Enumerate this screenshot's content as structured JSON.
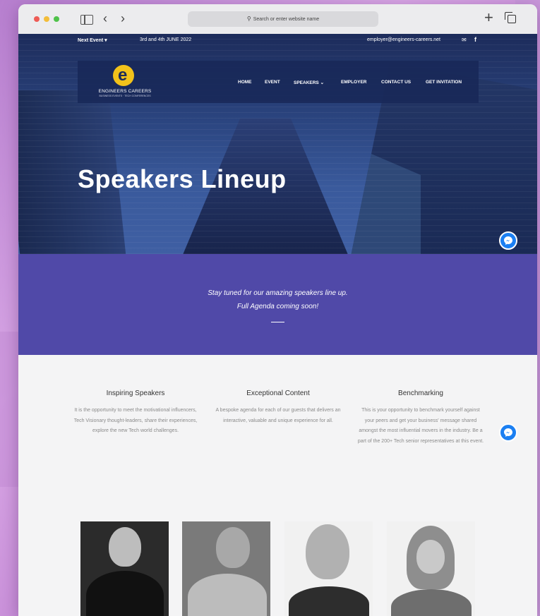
{
  "browser": {
    "address_placeholder": "Search or enter website name"
  },
  "topbar": {
    "next_event": "Next Event",
    "date": "3rd and 4th JUNE 2022",
    "email": "employer@engineers-careers.net"
  },
  "logo": {
    "name": "ENGINEERS CAREERS",
    "tagline": "BUSINESS EVENTS · TECH CONFERENCES"
  },
  "nav": [
    "HOME",
    "EVENT",
    "SPEAKERS",
    "EMPLOYER",
    "CONTACT US",
    "GET INVITATION"
  ],
  "hero": {
    "title": "Speakers Lineup"
  },
  "band": {
    "line1": "Stay tuned for our amazing speakers line up.",
    "line2": "Full Agenda coming soon!"
  },
  "features": [
    {
      "title": "Inspiring Speakers",
      "body": "It is the opportunity to meet the motivational influencers, Tech Visionary thought-leaders, share their experiences, explore the new Tech world challenges."
    },
    {
      "title": "Exceptional Content",
      "body": "A bespoke agenda for each of our guests that delivers an interactive, valuable and unique experience for all."
    },
    {
      "title": "Benchmarking",
      "body": "This is your opportunity to benchmark yourself against your peers and get your business' message shared amongst the most influential movers in the industry. Be a part of the 200+ Tech senior representatives at this event."
    }
  ],
  "colors": {
    "band": "#5049a8",
    "logo_accent": "#f2c21a",
    "messenger": "#1b7ff2"
  }
}
